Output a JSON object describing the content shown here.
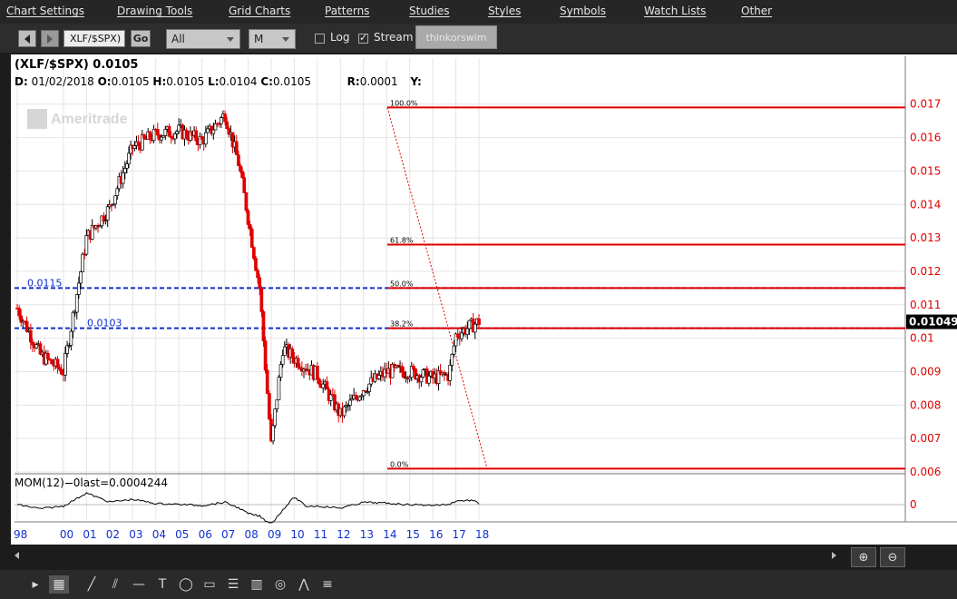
{
  "menu": {
    "items": [
      "Chart Settings",
      "Drawing Tools",
      "Grid Charts",
      "Patterns",
      "Studies",
      "Styles",
      "Symbols",
      "Watch Lists",
      "Other"
    ]
  },
  "toolbar": {
    "symbol": "XLF/$SPX)",
    "go_label": "Go",
    "range_value": "All",
    "aggregation_value": "M",
    "log_label": "Log",
    "log_checked": false,
    "stream_label": "Stream",
    "stream_checked": true,
    "platform_badge": "thinkorswim"
  },
  "chart_header": {
    "title": "(XLF/$SPX)  0.0105",
    "ohlc": {
      "d_label": "D:",
      "d_value": "01/02/2018",
      "o_label": "O:",
      "o_value": "0.0105",
      "h_label": "H:",
      "h_value": "0.0105",
      "l_label": "L:",
      "l_value": "0.0104",
      "c_label": "C:",
      "c_value": "0.0105",
      "r_label": "R:",
      "r_value": "0.0001",
      "y_label": "Y:"
    },
    "watermark": "Ameritrade"
  },
  "mom": {
    "label": "MOM(12)",
    "last_label": "0last=0.0004244",
    "zero_label": "0"
  },
  "chart_data": {
    "type": "candlestick",
    "aggregation": "monthly",
    "y_axis_ticks": [
      "0.017",
      "0.016",
      "0.015",
      "0.014",
      "0.013",
      "0.012",
      "0.011",
      "0.01",
      "0.009",
      "0.008",
      "0.007",
      "0.006"
    ],
    "ylim": [
      0.006,
      0.0174
    ],
    "x_axis_ticks": [
      "98",
      "00",
      "01",
      "02",
      "03",
      "04",
      "05",
      "06",
      "07",
      "08",
      "09",
      "10",
      "11",
      "12",
      "13",
      "14",
      "15",
      "16",
      "17",
      "18"
    ],
    "last_price_label": "0.01049",
    "fib_levels": [
      {
        "label": "100.0%",
        "value": 0.0169
      },
      {
        "label": "61.8%",
        "value": 0.0128
      },
      {
        "label": "50.0%",
        "value": 0.0115
      },
      {
        "label": "38.2%",
        "value": 0.0103
      },
      {
        "label": "0.0%",
        "value": 0.0061
      }
    ],
    "horizontal_lines": [
      {
        "label": "0.0115",
        "value": 0.0115
      },
      {
        "label": "0.0103",
        "value": 0.0103
      }
    ],
    "colors": {
      "up": "#ffffff",
      "down": "#e00000",
      "fib": "#e00000",
      "dashed": "#1030d0",
      "axis_text": "#e00000",
      "xaxis_text": "#1030d0"
    },
    "candles_yearly_approx": [
      {
        "t": 1998.0,
        "c": 0.0109
      },
      {
        "t": 1999.0,
        "c": 0.0095
      },
      {
        "t": 2000.0,
        "c": 0.009
      },
      {
        "t": 2000.5,
        "c": 0.011
      },
      {
        "t": 2001.0,
        "c": 0.013
      },
      {
        "t": 2002.0,
        "c": 0.0139
      },
      {
        "t": 2003.0,
        "c": 0.0157
      },
      {
        "t": 2004.0,
        "c": 0.0161
      },
      {
        "t": 2005.0,
        "c": 0.0162
      },
      {
        "t": 2006.0,
        "c": 0.0159
      },
      {
        "t": 2007.0,
        "c": 0.0167
      },
      {
        "t": 2007.6,
        "c": 0.0152
      },
      {
        "t": 2008.0,
        "c": 0.0136
      },
      {
        "t": 2008.5,
        "c": 0.0115
      },
      {
        "t": 2009.0,
        "c": 0.0068
      },
      {
        "t": 2009.5,
        "c": 0.0097
      },
      {
        "t": 2010.0,
        "c": 0.0094
      },
      {
        "t": 2011.0,
        "c": 0.0089
      },
      {
        "t": 2012.0,
        "c": 0.0077
      },
      {
        "t": 2013.0,
        "c": 0.0085
      },
      {
        "t": 2014.0,
        "c": 0.009
      },
      {
        "t": 2015.0,
        "c": 0.009
      },
      {
        "t": 2016.0,
        "c": 0.0088
      },
      {
        "t": 2016.7,
        "c": 0.0089
      },
      {
        "t": 2017.0,
        "c": 0.0101
      },
      {
        "t": 2018.0,
        "c": 0.0105
      }
    ]
  },
  "drawing_tools": [
    "cursor-icon",
    "grid-icon",
    "pencil-icon",
    "trendline-icon",
    "horizontal-line-icon",
    "text-icon",
    "ellipse-icon",
    "rectangle-icon",
    "fibonacci-icon",
    "gann-icon",
    "cycle-icon",
    "andrews-pitchfork-icon",
    "more-icon"
  ]
}
